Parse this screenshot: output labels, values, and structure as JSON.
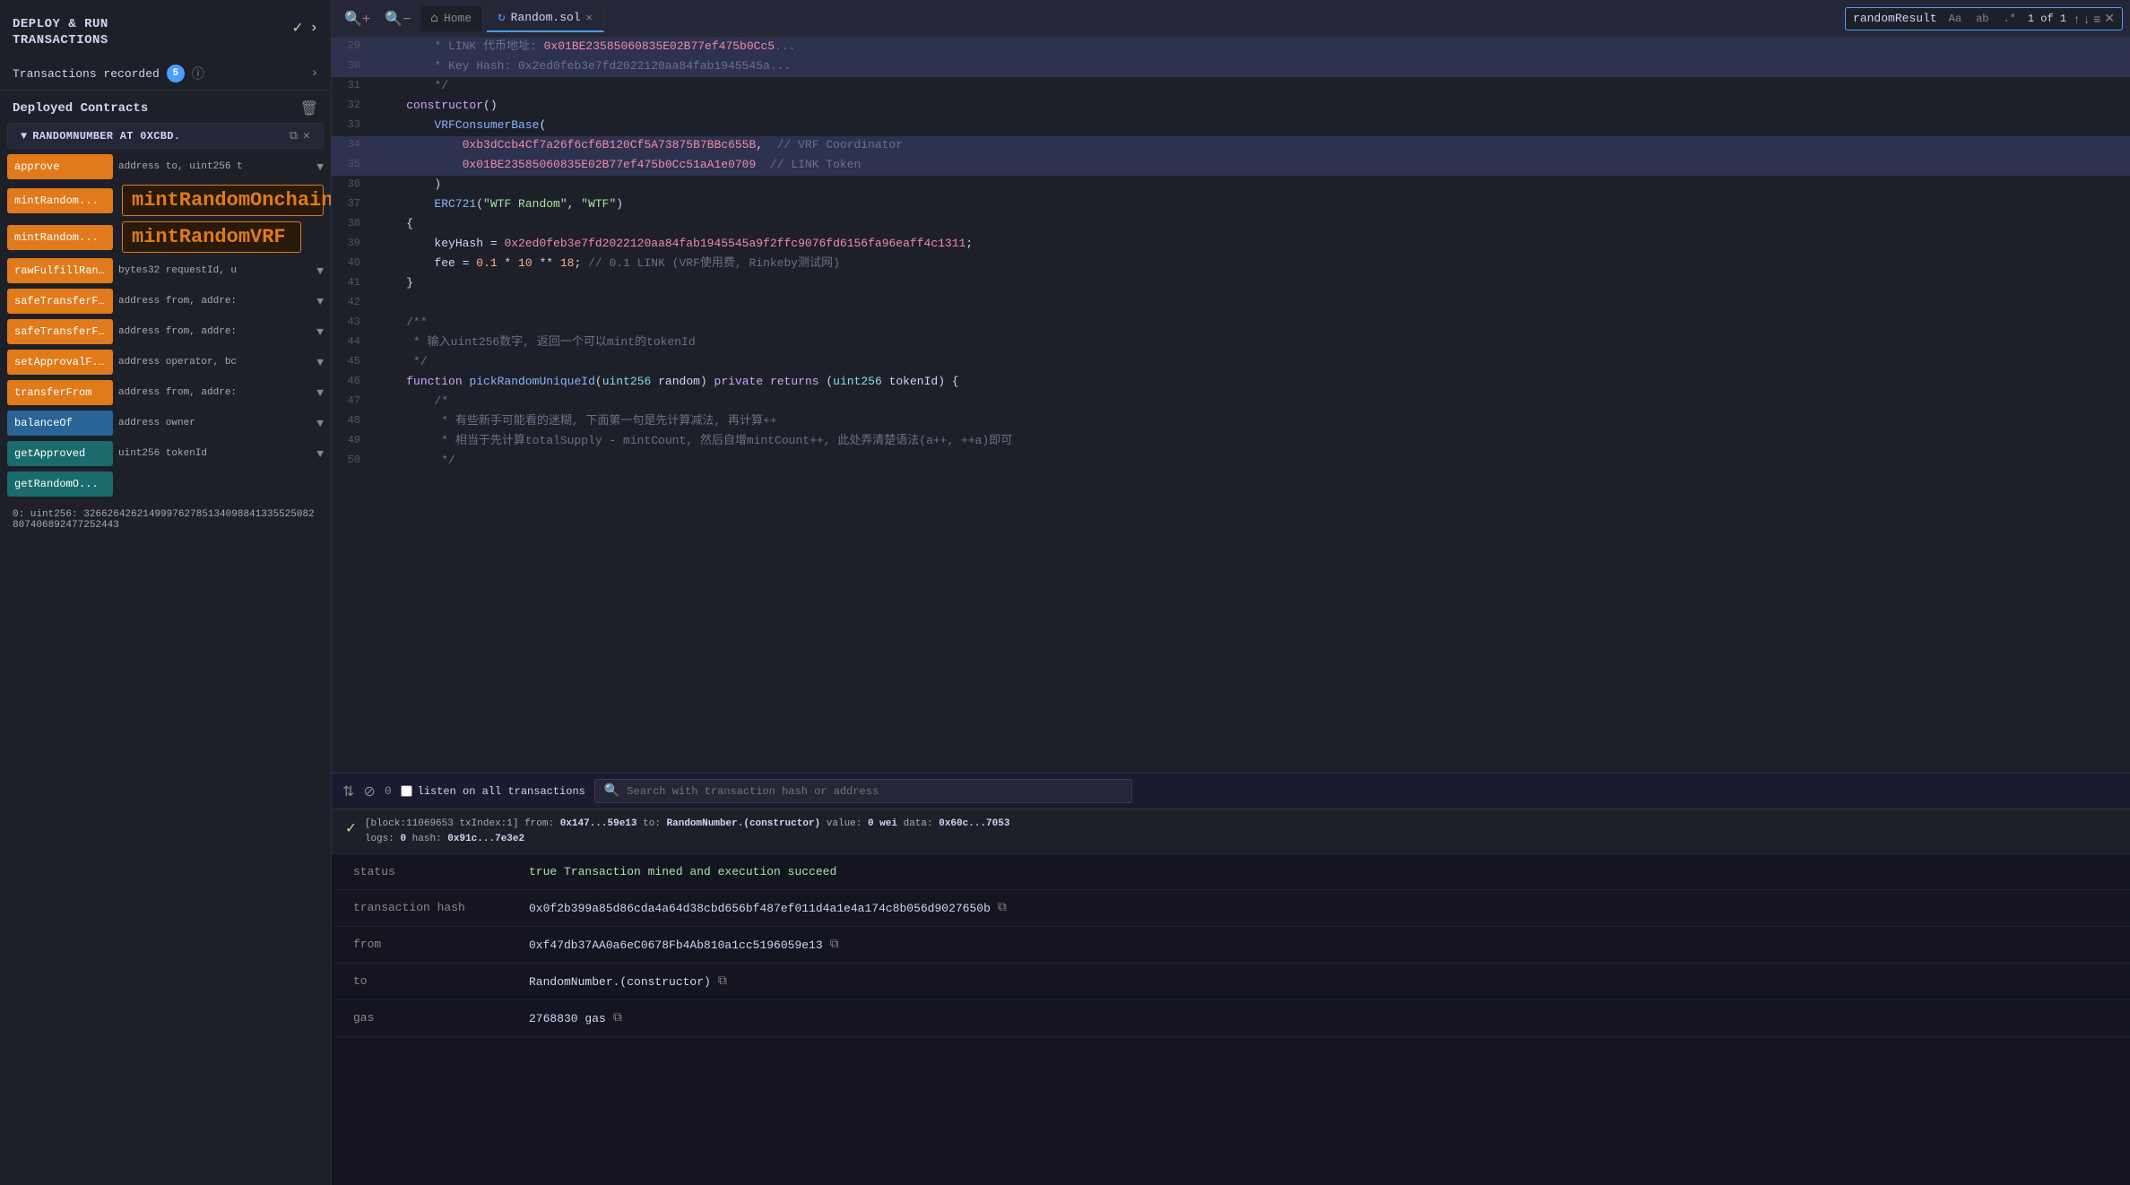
{
  "left": {
    "title": "DEPLOY & RUN\nTRANSACTIONS",
    "transactions_label": "Transactions recorded",
    "transactions_count": "5",
    "deployed_contracts_label": "Deployed Contracts",
    "contract_name": "RANDOMNUMBER AT 0XCBD.",
    "functions": [
      {
        "label": "approve",
        "param": "address to, uint256 t",
        "has_chevron": true,
        "type": "orange"
      },
      {
        "label": "mintRandom...",
        "tooltip": "mintRandomOnchain",
        "type": "orange"
      },
      {
        "label": "mintRandom...",
        "tooltip": "mintRandomVRF",
        "type": "orange"
      },
      {
        "label": "rawFulfillRan...",
        "param": "bytes32 requestId, u",
        "has_chevron": true,
        "type": "orange"
      },
      {
        "label": "safeTransferF...",
        "param": "address from, addre:",
        "has_chevron": true,
        "type": "orange"
      },
      {
        "label": "safeTransferF...",
        "param": "address from, addre:",
        "has_chevron": true,
        "type": "orange"
      },
      {
        "label": "setApprovalF...",
        "param": "address operator, bc",
        "has_chevron": true,
        "type": "orange"
      },
      {
        "label": "transferFrom",
        "param": "address from, addre:",
        "has_chevron": true,
        "type": "orange"
      },
      {
        "label": "balanceOf",
        "param": "address owner",
        "has_chevron": true,
        "type": "blue"
      },
      {
        "label": "getApproved",
        "param": "uint256 tokenId",
        "has_chevron": true,
        "type": "teal"
      },
      {
        "label": "getRandomO...",
        "param": "",
        "has_chevron": false,
        "type": "teal"
      }
    ],
    "result_label": "0: uint256: 326626426214999762785134098841335525082807406892477252443"
  },
  "editor": {
    "home_tab": "Home",
    "file_tab": "Random.sol",
    "search_term": "randomResult",
    "search_count": "1 of 1",
    "lines": [
      {
        "num": 29,
        "content": "        * LINK 代币地址: 0x01BE23585060835E02B77ef475b0Cc5...",
        "highlight": true
      },
      {
        "num": 30,
        "content": "        * Key Hash: 0x2ed0feb3e7fd2022120aa84fab1945545a..."
      },
      {
        "num": 31,
        "content": "        */"
      },
      {
        "num": 32,
        "content": "    constructor()"
      },
      {
        "num": 33,
        "content": "        VRFConsumerBase("
      },
      {
        "num": 34,
        "content": "            0xb3dCcb4Cf7a26f6cf6B120Cf5A73875B7BBc655B,  // VRF Coordinator",
        "highlight": true
      },
      {
        "num": 35,
        "content": "            0x01BE23585060835E02B77ef475b0Cc51aA1e0709  // LINK Token",
        "highlight": true
      },
      {
        "num": 36,
        "content": "        )"
      },
      {
        "num": 37,
        "content": "        ERC721(\"WTF Random\", \"WTF\")"
      },
      {
        "num": 38,
        "content": "    {"
      },
      {
        "num": 39,
        "content": "        keyHash = 0x2ed0feb3e7fd2022120aa84fab1945545a9f2ffc9076fd6156fa96eaff4c1311;"
      },
      {
        "num": 40,
        "content": "        fee = 0.1 * 10 ** 18; // 0.1 LINK (VRF使用费, Rinkeby测试网)"
      },
      {
        "num": 41,
        "content": "    }"
      },
      {
        "num": 42,
        "content": ""
      },
      {
        "num": 43,
        "content": "    /**"
      },
      {
        "num": 44,
        "content": "     * 输入uint256数字, 返回一个可以mint的tokenId"
      },
      {
        "num": 45,
        "content": "     */"
      },
      {
        "num": 46,
        "content": "    function pickRandomUniqueId(uint256 random) private returns (uint256 tokenId) {"
      },
      {
        "num": 47,
        "content": "        /*"
      },
      {
        "num": 48,
        "content": "         * 有些新手可能看的迷糊, 下面第一句是先计算减法, 再计算++"
      },
      {
        "num": 49,
        "content": "         * 相当于先计算totalSupply - mintCount, 然后自增mintCount++, 此处弄清楚语法(a++, ++a)即可"
      },
      {
        "num": 50,
        "content": "         */"
      }
    ]
  },
  "bottom": {
    "listen_label": "listen on all transactions",
    "search_placeholder": "Search with transaction hash or address",
    "tx_header": "[block:11069653 txIndex:1] from: 0x147...59e13 to: RandomNumber.(constructor) value: 0 wei data: 0x60c...7053\nlogs: 0 hash: 0x91c...7e3e2",
    "tx_rows": [
      {
        "key": "status",
        "value": "true Transaction mined and execution succeed",
        "type": "success"
      },
      {
        "key": "transaction hash",
        "value": "0x0f2b399a85d86cda4a64d38cbd656bf487ef011d4a1e4a174c8b056d9027650b",
        "copy": true
      },
      {
        "key": "from",
        "value": "0xf47db37AA0a6eC0678Fb4Ab810a1cc5196059e13",
        "copy": true
      },
      {
        "key": "to",
        "value": "RandomNumber.(constructor)",
        "copy": true
      },
      {
        "key": "gas",
        "value": "2768830 gas",
        "copy": true
      }
    ]
  }
}
